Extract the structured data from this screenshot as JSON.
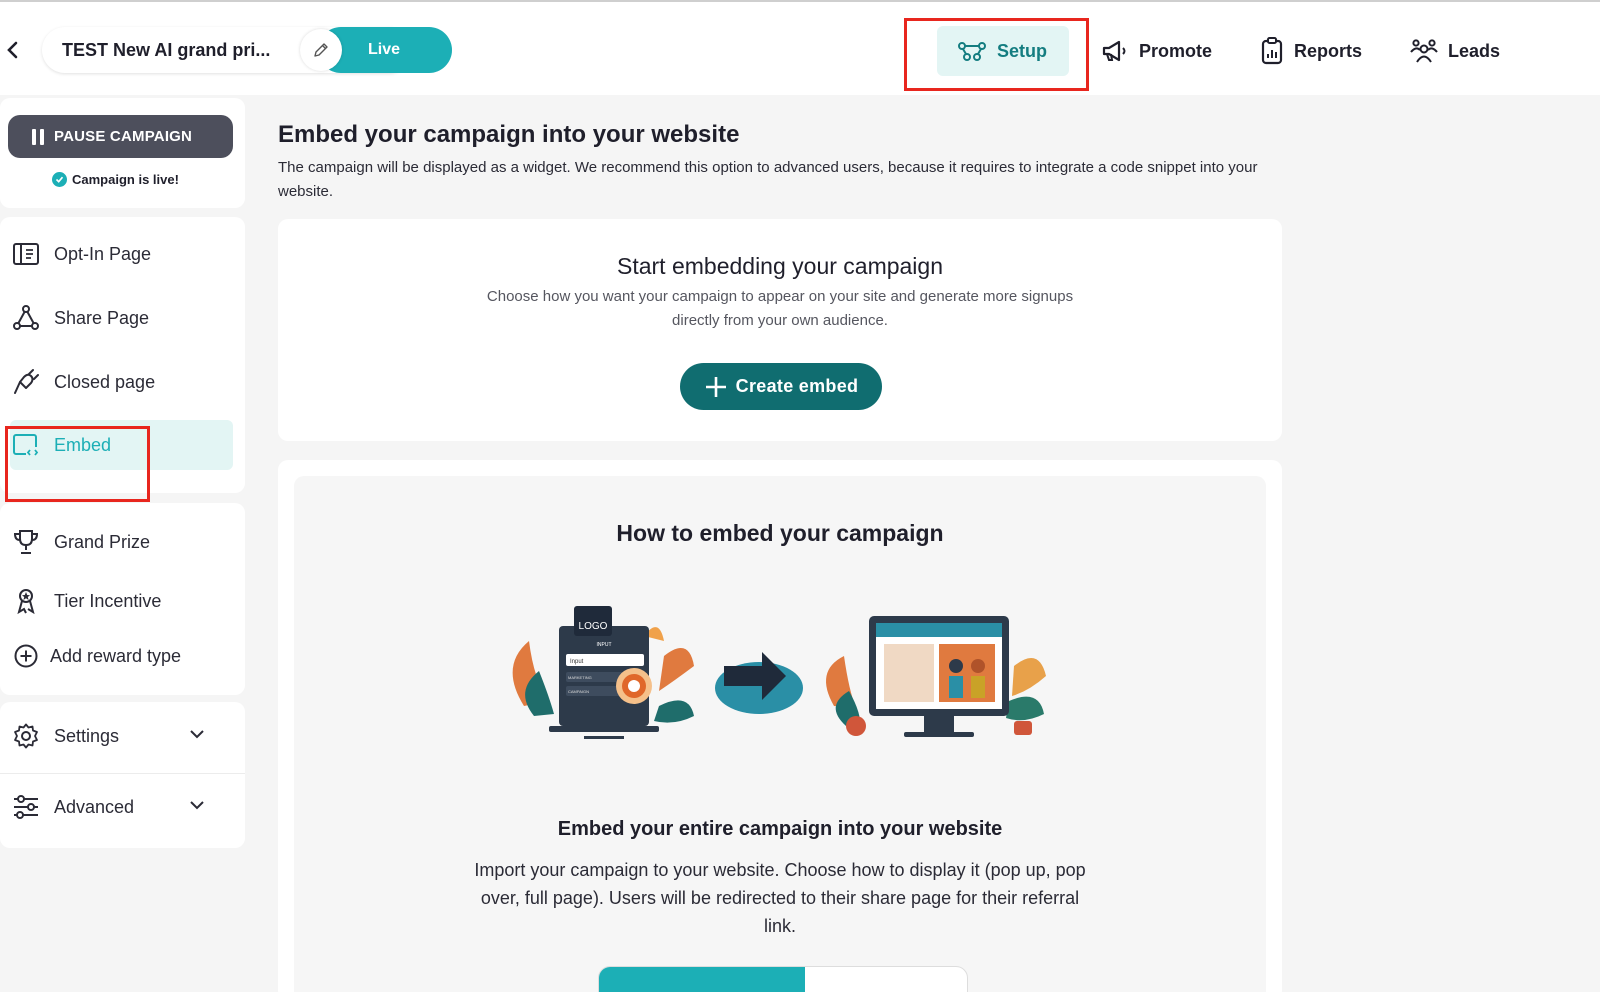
{
  "header": {
    "campaign_name": "TEST New AI grand pri...",
    "live_label": "Live",
    "nav": [
      {
        "label": "Setup",
        "icon": "setup-icon"
      },
      {
        "label": "Promote",
        "icon": "megaphone-icon"
      },
      {
        "label": "Reports",
        "icon": "clipboard-icon"
      },
      {
        "label": "Leads",
        "icon": "people-icon"
      }
    ]
  },
  "sidebar": {
    "pause_label": "PAUSE CAMPAIGN",
    "status_text": "Campaign is live!",
    "pages": [
      {
        "label": "Opt-In Page",
        "icon": "opt-in-icon"
      },
      {
        "label": "Share Page",
        "icon": "share-icon"
      },
      {
        "label": "Closed page",
        "icon": "plug-icon"
      },
      {
        "label": "Embed",
        "icon": "embed-icon"
      }
    ],
    "rewards": [
      {
        "label": "Grand Prize",
        "icon": "trophy-icon"
      },
      {
        "label": "Tier Incentive",
        "icon": "award-icon"
      },
      {
        "label": "Add reward type",
        "icon": "plus-circle-icon"
      }
    ],
    "settings_label": "Settings",
    "advanced_label": "Advanced"
  },
  "main": {
    "title": "Embed your campaign into your website",
    "description": "The campaign will be displayed as a widget. We recommend this option to advanced users, because it requires to integrate a code snippet into your website.",
    "embed_card": {
      "heading": "Start embedding your campaign",
      "text": "Choose how you want your campaign to appear on your site and generate more signups directly from your own audience.",
      "button_label": "Create embed"
    },
    "howto": {
      "title": "How to embed your campaign",
      "subtitle": "Embed your entire campaign into your website",
      "text": "Import your campaign to your website. Choose how to display it (pop up, pop over, full page). Users will be redirected to their share page for their referral link.",
      "illus_logo": "LOGO",
      "illus_input": "INPUT",
      "illus_field": "Input",
      "illus_line1": "MARKETING",
      "illus_line2": "CAMPAIGN"
    }
  },
  "colors": {
    "accent": "#1cafb6",
    "button_dark": "#106d70",
    "highlight": "#e8261e"
  }
}
